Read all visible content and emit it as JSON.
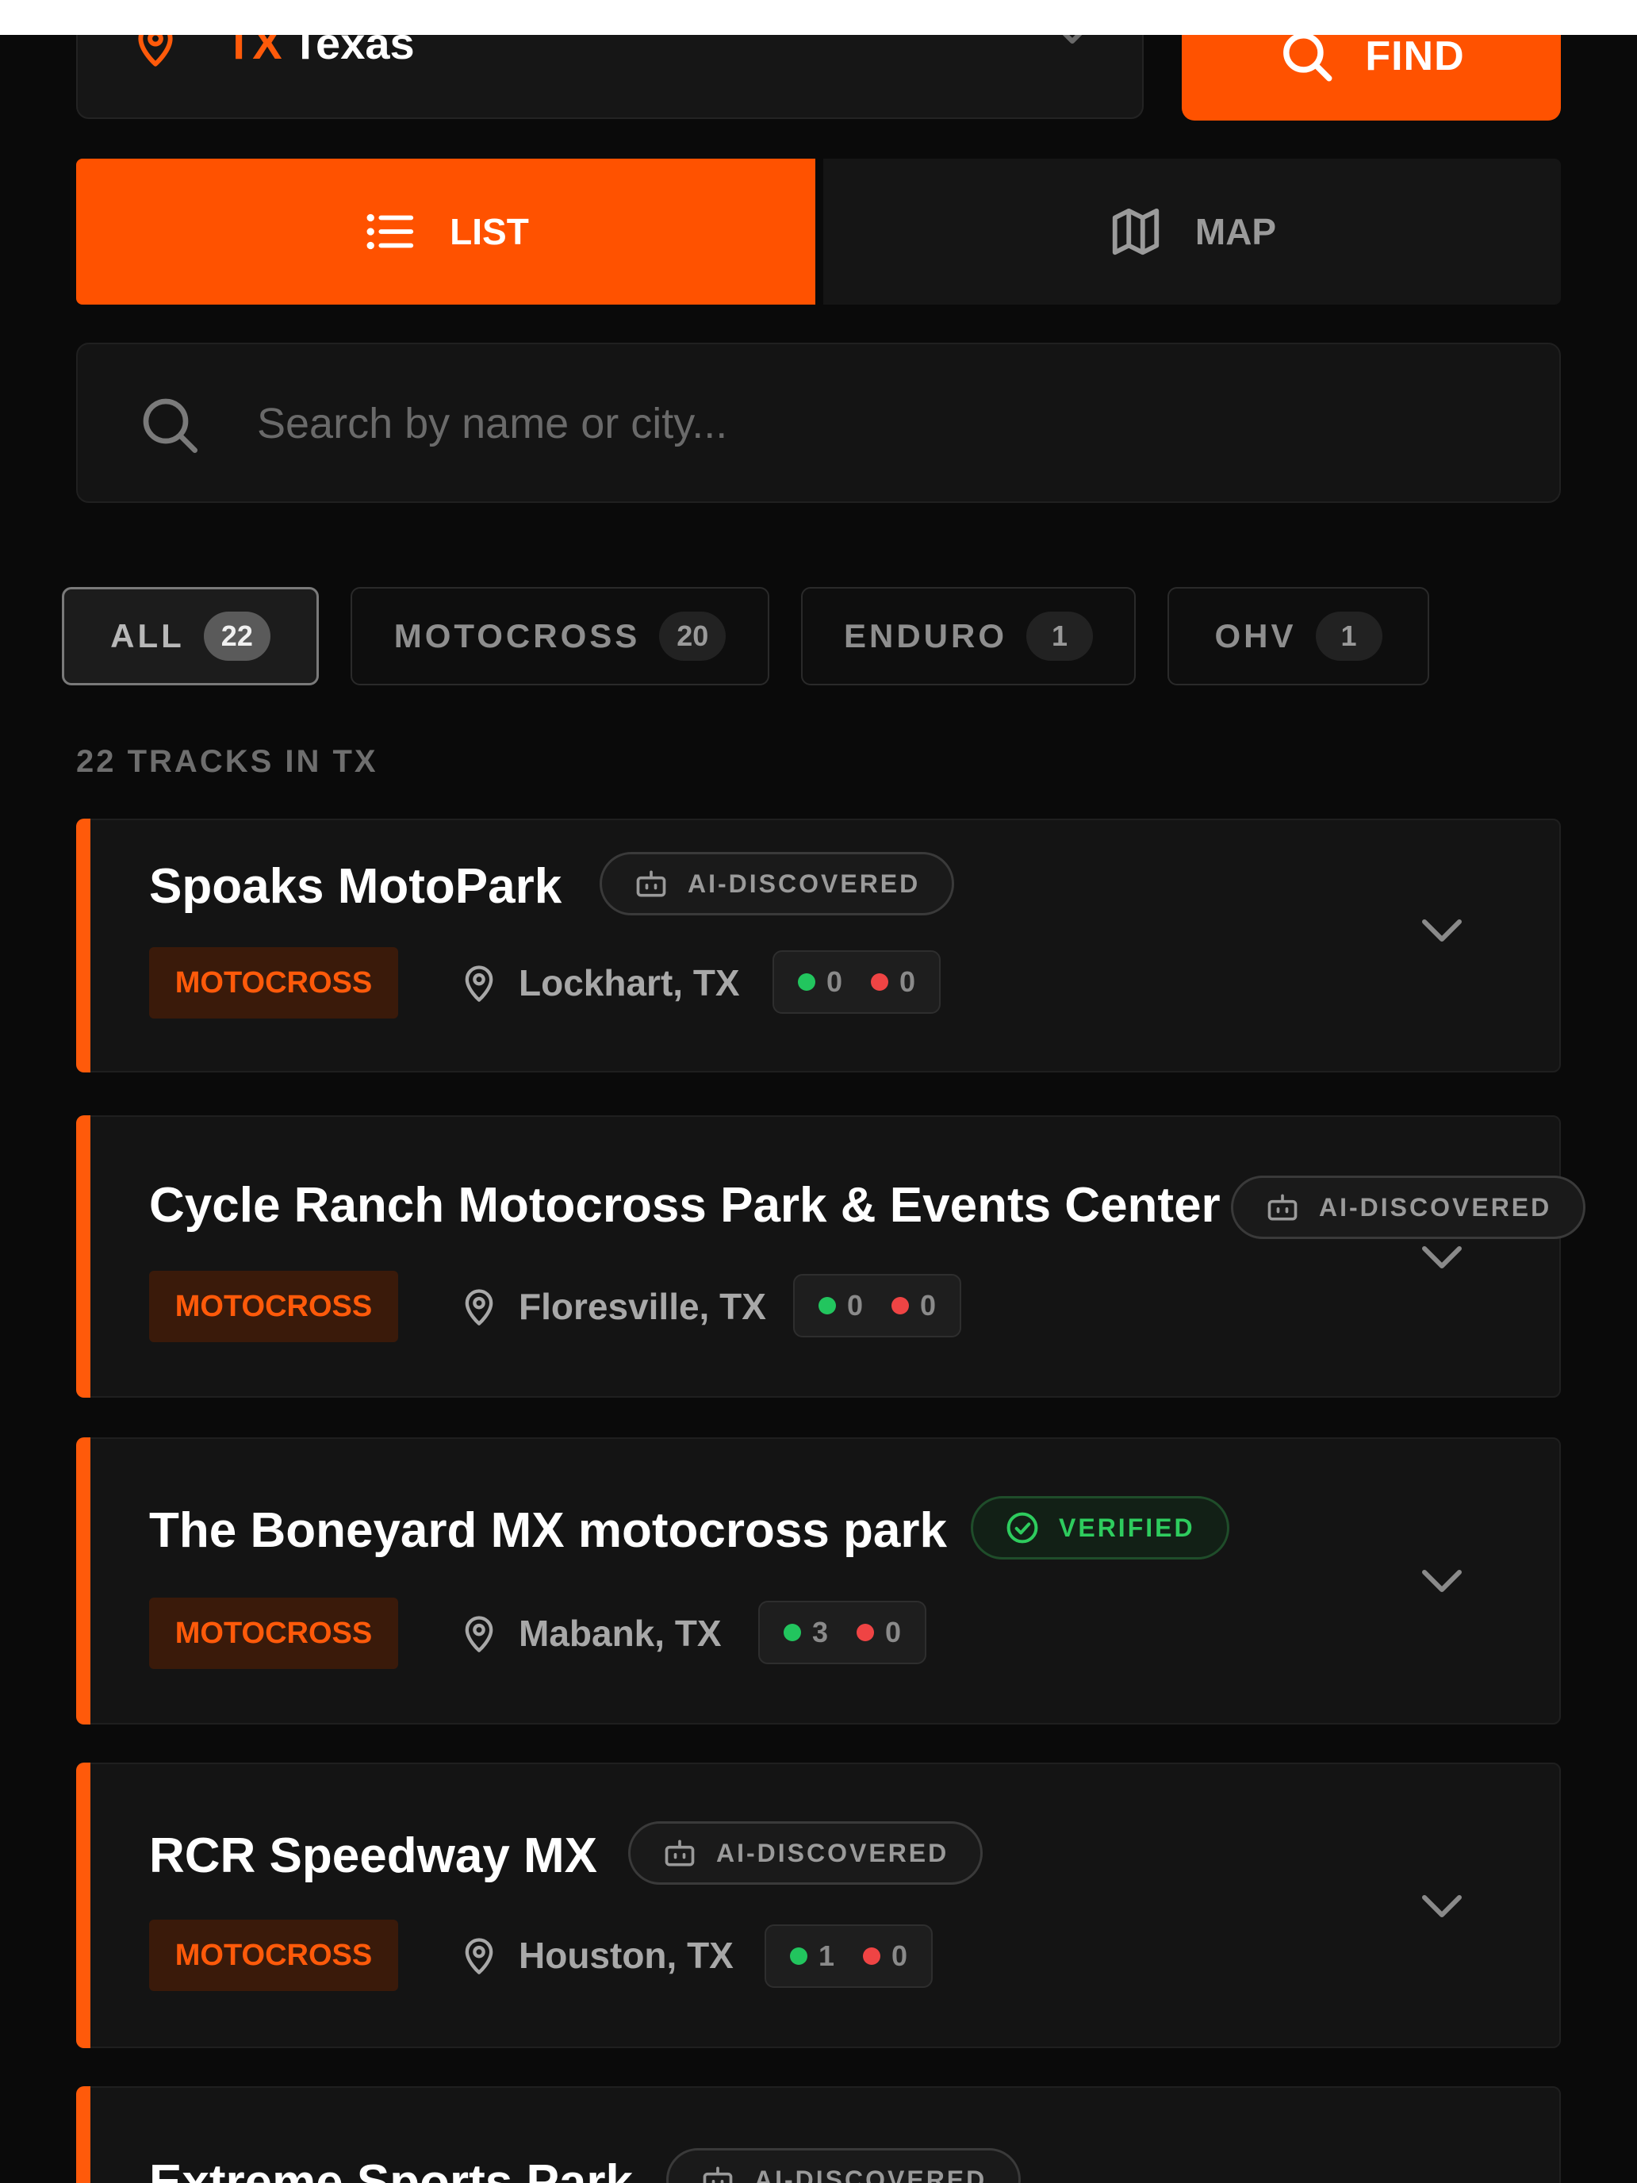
{
  "state_selector": {
    "code": "TX",
    "name": "Texas"
  },
  "find_button": {
    "label": "FIND"
  },
  "view_toggle": {
    "list_label": "LIST",
    "map_label": "MAP"
  },
  "search": {
    "placeholder": "Search by name or city...",
    "value": ""
  },
  "filters": [
    {
      "label": "ALL",
      "count": "22",
      "active": true
    },
    {
      "label": "MOTOCROSS",
      "count": "20",
      "active": false
    },
    {
      "label": "ENDURO",
      "count": "1",
      "active": false
    },
    {
      "label": "OHV",
      "count": "1",
      "active": false
    }
  ],
  "results_label": "22 TRACKS IN TX",
  "tracks": [
    {
      "name": "Spoaks MotoPark",
      "badge": "AI-DISCOVERED",
      "type": "MOTOCROSS",
      "location": "Lockhart, TX",
      "up": "0",
      "down": "0"
    },
    {
      "name": "Cycle Ranch Motocross Park & Events Center",
      "badge": "AI-DISCOVERED",
      "type": "MOTOCROSS",
      "location": "Floresville, TX",
      "up": "0",
      "down": "0"
    },
    {
      "name": "The Boneyard MX motocross park",
      "badge": "VERIFIED",
      "type": "MOTOCROSS",
      "location": "Mabank, TX",
      "up": "3",
      "down": "0"
    },
    {
      "name": "RCR Speedway MX",
      "badge": "AI-DISCOVERED",
      "type": "MOTOCROSS",
      "location": "Houston, TX",
      "up": "1",
      "down": "0"
    },
    {
      "name": "Extreme Sports Park",
      "badge": "AI-DISCOVERED"
    }
  ],
  "colors": {
    "accent": "#ff5200",
    "verified": "#2ecc5e",
    "up_vote": "#22c55e",
    "down_vote": "#ef4444"
  },
  "icons": {
    "state": "map-pin-icon",
    "find": "search-icon",
    "list": "list-icon",
    "map": "map-icon",
    "ai": "robot-icon",
    "verified": "check-circle-icon",
    "location": "map-pin-icon",
    "expand": "chevron-down-icon"
  }
}
